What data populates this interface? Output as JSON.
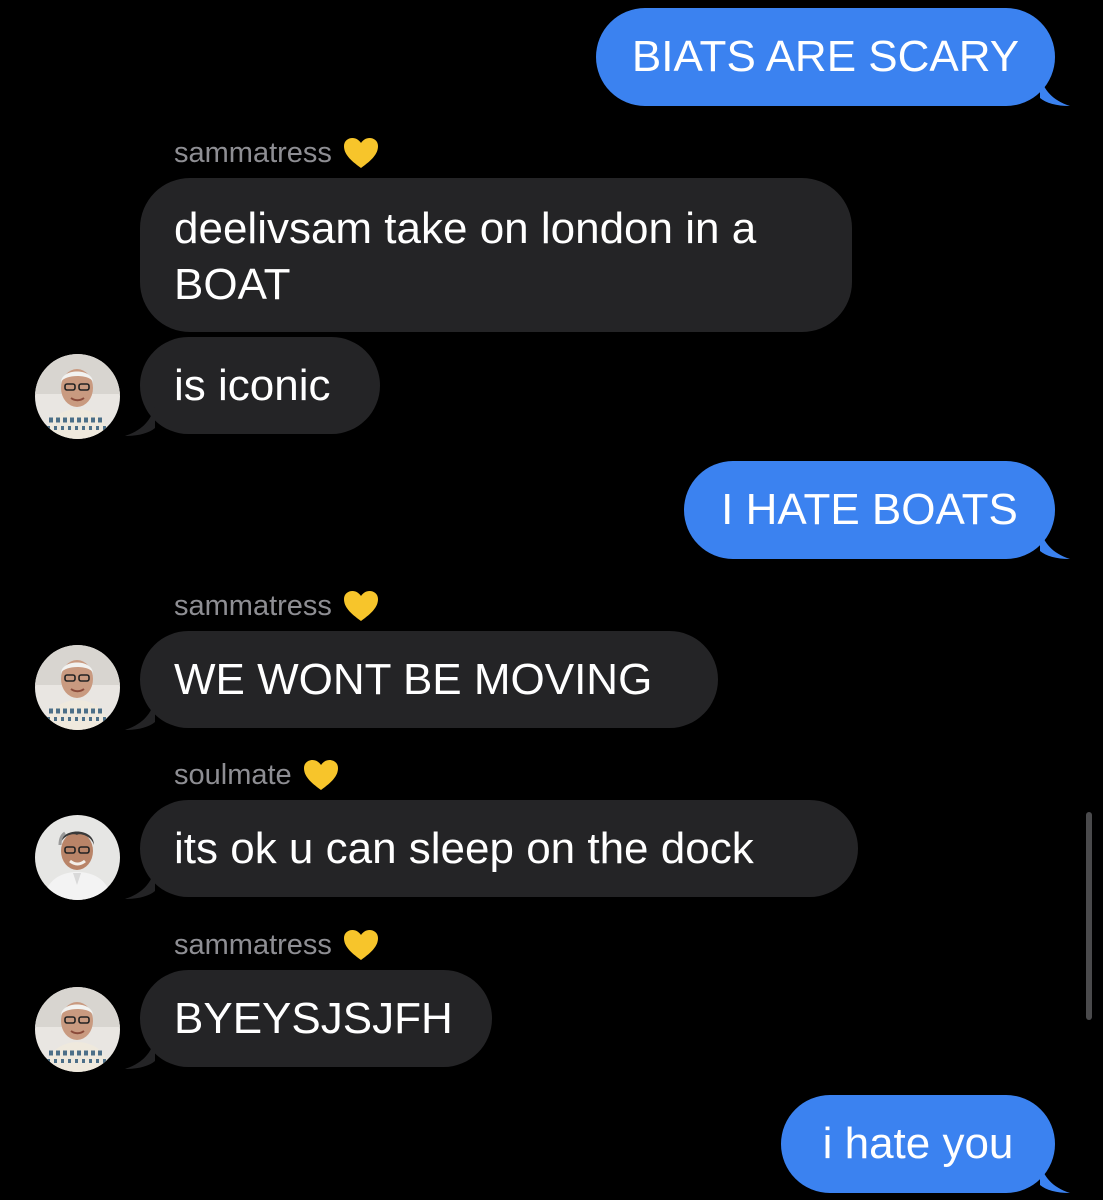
{
  "conversation": {
    "messages": [
      {
        "direction": "sent",
        "text": "BIATS ARE SCARY"
      },
      {
        "direction": "received",
        "sender": "sammatress",
        "sender_emoji": "yellow-heart",
        "text": "deelivsam take on london in a BOAT"
      },
      {
        "direction": "received",
        "sender": "sammatress",
        "text": "is iconic"
      },
      {
        "direction": "sent",
        "text": "I HATE BOATS"
      },
      {
        "direction": "received",
        "sender": "sammatress",
        "sender_emoji": "yellow-heart",
        "text": "WE WONT BE MOVING"
      },
      {
        "direction": "received",
        "sender": "soulmate",
        "sender_emoji": "yellow-heart",
        "text": "its ok u can sleep on the dock"
      },
      {
        "direction": "received",
        "sender": "sammatress",
        "sender_emoji": "yellow-heart",
        "text": "BYEYSJSJFH"
      },
      {
        "direction": "sent",
        "text": "i hate you"
      }
    ],
    "senders": {
      "sammatress": "sammatress",
      "soulmate": "soulmate"
    },
    "colors": {
      "background": "#000000",
      "sent_bubble": "#3b82f0",
      "received_bubble": "#242426",
      "sender_label": "#8e8e93",
      "heart": "#f7c52b"
    }
  }
}
